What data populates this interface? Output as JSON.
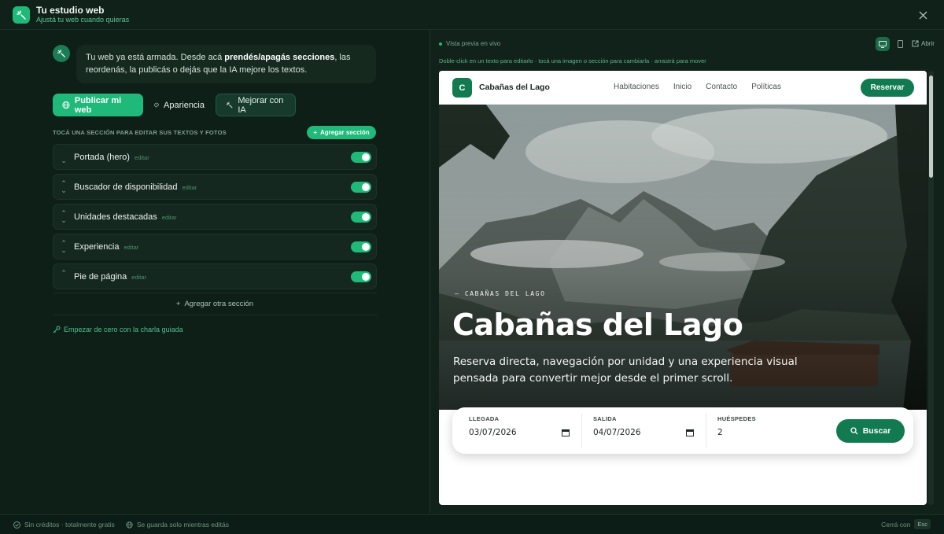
{
  "app": {
    "title": "Tu estudio web",
    "subtitle": "Ajustá tu web cuando quieras"
  },
  "assistant": {
    "message_part1": "Tu web ya está armada. Desde acá ",
    "message_bold": "prendés/apagás secciones",
    "message_part2": ", las reordenás, la publicás o dejás que la IA mejore los textos."
  },
  "actions": {
    "publish": "Publicar mi web",
    "appearance": "Apariencia",
    "improve": "Mejorar con IA"
  },
  "sections_panel": {
    "heading": "TOCÁ UNA SECCIÓN PARA EDITAR SUS TEXTOS Y FOTOS",
    "add_button": "Agregar sección",
    "edit_label": "editar",
    "items": [
      {
        "name": "Portada (hero)",
        "enabled": true,
        "arrows": [
          "",
          "⌄"
        ]
      },
      {
        "name": "Buscador de disponibilidad",
        "enabled": true,
        "arrows": [
          "⌃",
          "⌄"
        ]
      },
      {
        "name": "Unidades destacadas",
        "enabled": true,
        "arrows": [
          "⌃",
          "⌄"
        ]
      },
      {
        "name": "Experiencia",
        "enabled": true,
        "arrows": [
          "⌃",
          "⌄"
        ]
      },
      {
        "name": "Pie de página",
        "enabled": true,
        "arrows": [
          "⌃",
          ""
        ]
      }
    ],
    "add_other": "Agregar otra sección",
    "restart": "Empezar de cero con la charla guiada"
  },
  "preview": {
    "live_label": "Vista previa en vivo",
    "hint": "Doble-click en un texto para editarlo · tocá una imagen o sección para cambiarla · arrastrá para mover",
    "open_label": "Abrir",
    "site": {
      "logo_letter": "C",
      "name": "Cabañas del Lago",
      "nav": [
        "Habitaciones",
        "Inicio",
        "Contacto",
        "Políticas"
      ],
      "cta": "Reservar",
      "eyebrow": "CABAÑAS DEL LAGO",
      "hero_title": "Cabañas del Lago",
      "hero_desc": "Reserva directa, navegación por unidad y una experiencia visual pensada para convertir mejor desde el primer scroll.",
      "search": {
        "checkin_label": "LLEGADA",
        "checkin_value": "03/07/2026",
        "checkout_label": "SALIDA",
        "checkout_value": "04/07/2026",
        "guests_label": "HUÉSPEDES",
        "guests_value": "2",
        "button": "Buscar"
      }
    }
  },
  "footer": {
    "credits": "Sin créditos · totalmente gratis",
    "autosave": "Se guarda solo mientras editás",
    "close_hint": "Cerrá con",
    "close_key": "Esc"
  },
  "colors": {
    "accent": "#1fb97a",
    "brand_dark": "#127a50",
    "background": "#0c1c16"
  }
}
